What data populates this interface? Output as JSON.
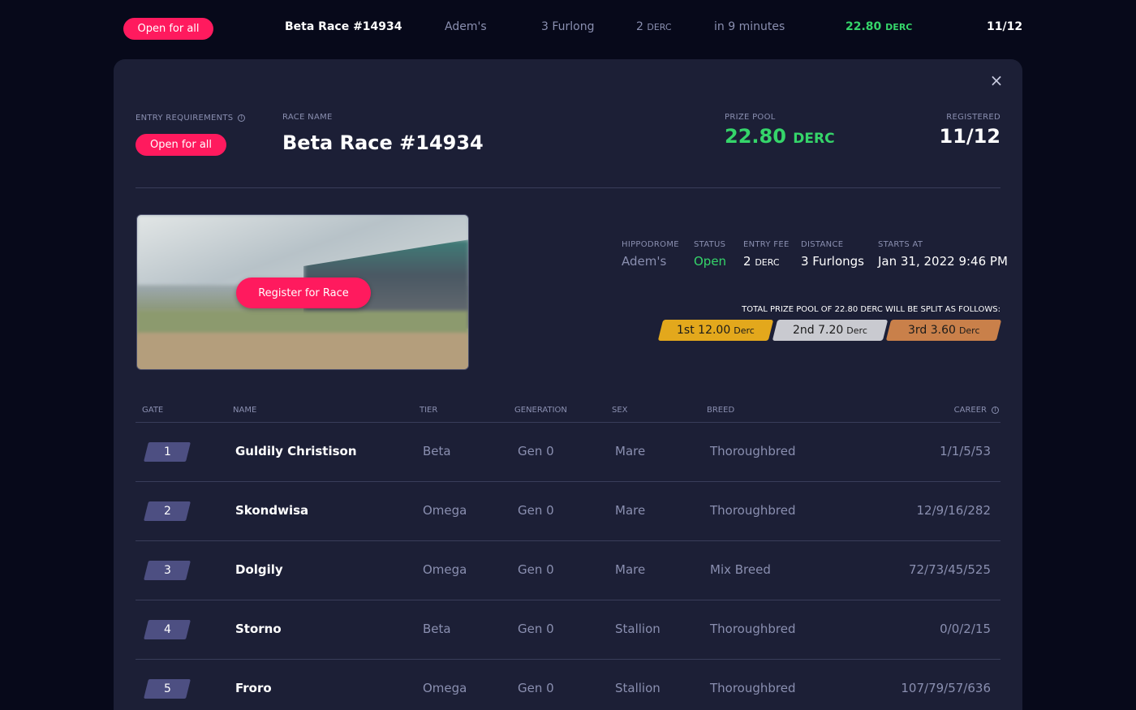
{
  "top_row": {
    "badge": "Open for all",
    "race_name": "Beta Race #14934",
    "hippodrome": "Adem's",
    "distance": "3 Furlong",
    "entry_fee_value": "2",
    "entry_fee_unit": "DERC",
    "starts": "in 9 minutes",
    "prize_value": "22.80",
    "prize_unit": "DERC",
    "registered": "11/12"
  },
  "panel": {
    "close_icon": "×",
    "entry_requirements_label": "ENTRY REQUIREMENTS",
    "entry_badge": "Open for all",
    "race_name_label": "RACE NAME",
    "race_name": "Beta Race #14934",
    "prize_pool_label": "PRIZE POOL",
    "prize_pool_value": "22.80",
    "prize_pool_unit": "DERC",
    "registered_label": "REGISTERED",
    "registered_value": "11/12",
    "register_button": "Register for Race",
    "details": {
      "hippodrome_label": "HIPPODROME",
      "hippodrome": "Adem's",
      "status_label": "STATUS",
      "status": "Open",
      "entry_fee_label": "ENTRY FEE",
      "entry_fee_value": "2",
      "entry_fee_unit": "DERC",
      "distance_label": "DISTANCE",
      "distance": "3 Furlongs",
      "starts_at_label": "STARTS AT",
      "starts_at": "Jan 31, 2022 9:46 PM"
    },
    "split_title": "TOTAL PRIZE POOL OF 22.80 DERC WILL BE SPLIT AS FOLLOWS:",
    "prizes": [
      {
        "place": "1st",
        "amount": "12.00",
        "unit": "Derc",
        "color": "#e3a81c"
      },
      {
        "place": "2nd",
        "amount": "7.20",
        "unit": "Derc",
        "color": "#c9cad0"
      },
      {
        "place": "3rd",
        "amount": "3.60",
        "unit": "Derc",
        "color": "#c9804a"
      }
    ]
  },
  "table": {
    "headers": {
      "gate": "GATE",
      "name": "NAME",
      "tier": "TIER",
      "generation": "GENERATION",
      "sex": "SEX",
      "breed": "BREED",
      "career": "CAREER"
    },
    "rows": [
      {
        "gate": "1",
        "name": "Guldily Christison",
        "tier": "Beta",
        "generation": "Gen 0",
        "sex": "Mare",
        "breed": "Thoroughbred",
        "career": "1/1/5/53"
      },
      {
        "gate": "2",
        "name": "Skondwisa",
        "tier": "Omega",
        "generation": "Gen 0",
        "sex": "Mare",
        "breed": "Thoroughbred",
        "career": "12/9/16/282"
      },
      {
        "gate": "3",
        "name": "Dolgily",
        "tier": "Omega",
        "generation": "Gen 0",
        "sex": "Mare",
        "breed": "Mix Breed",
        "career": "72/73/45/525"
      },
      {
        "gate": "4",
        "name": "Storno",
        "tier": "Beta",
        "generation": "Gen 0",
        "sex": "Stallion",
        "breed": "Thoroughbred",
        "career": "0/0/2/15"
      },
      {
        "gate": "5",
        "name": "Froro",
        "tier": "Omega",
        "generation": "Gen 0",
        "sex": "Stallion",
        "breed": "Thoroughbred",
        "career": "107/79/57/636"
      }
    ]
  },
  "colors": {
    "accent": "#ff1a5e",
    "green": "#35d56a",
    "background": "#07091a",
    "panel": "#1c1f36"
  }
}
